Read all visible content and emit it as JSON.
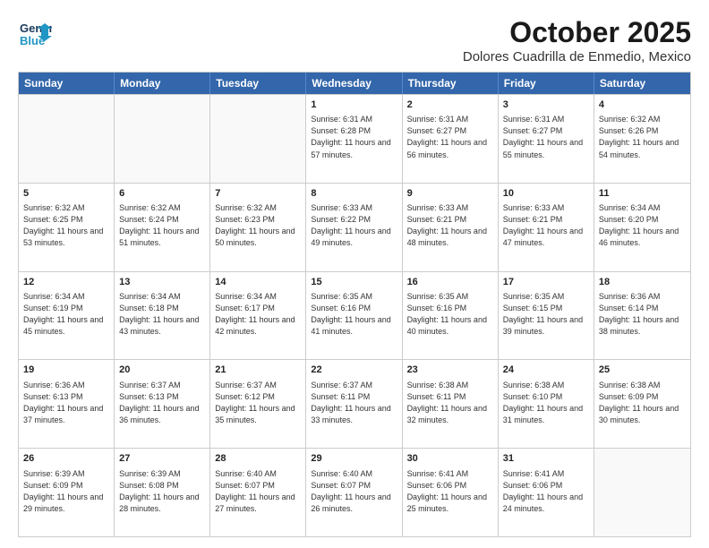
{
  "header": {
    "logo_general": "General",
    "logo_blue": "Blue",
    "month_title": "October 2025",
    "subtitle": "Dolores Cuadrilla de Enmedio, Mexico"
  },
  "days_of_week": [
    "Sunday",
    "Monday",
    "Tuesday",
    "Wednesday",
    "Thursday",
    "Friday",
    "Saturday"
  ],
  "weeks": [
    [
      {
        "day": "",
        "info": ""
      },
      {
        "day": "",
        "info": ""
      },
      {
        "day": "",
        "info": ""
      },
      {
        "day": "1",
        "info": "Sunrise: 6:31 AM\nSunset: 6:28 PM\nDaylight: 11 hours\nand 57 minutes."
      },
      {
        "day": "2",
        "info": "Sunrise: 6:31 AM\nSunset: 6:27 PM\nDaylight: 11 hours\nand 56 minutes."
      },
      {
        "day": "3",
        "info": "Sunrise: 6:31 AM\nSunset: 6:27 PM\nDaylight: 11 hours\nand 55 minutes."
      },
      {
        "day": "4",
        "info": "Sunrise: 6:32 AM\nSunset: 6:26 PM\nDaylight: 11 hours\nand 54 minutes."
      }
    ],
    [
      {
        "day": "5",
        "info": "Sunrise: 6:32 AM\nSunset: 6:25 PM\nDaylight: 11 hours\nand 53 minutes."
      },
      {
        "day": "6",
        "info": "Sunrise: 6:32 AM\nSunset: 6:24 PM\nDaylight: 11 hours\nand 51 minutes."
      },
      {
        "day": "7",
        "info": "Sunrise: 6:32 AM\nSunset: 6:23 PM\nDaylight: 11 hours\nand 50 minutes."
      },
      {
        "day": "8",
        "info": "Sunrise: 6:33 AM\nSunset: 6:22 PM\nDaylight: 11 hours\nand 49 minutes."
      },
      {
        "day": "9",
        "info": "Sunrise: 6:33 AM\nSunset: 6:21 PM\nDaylight: 11 hours\nand 48 minutes."
      },
      {
        "day": "10",
        "info": "Sunrise: 6:33 AM\nSunset: 6:21 PM\nDaylight: 11 hours\nand 47 minutes."
      },
      {
        "day": "11",
        "info": "Sunrise: 6:34 AM\nSunset: 6:20 PM\nDaylight: 11 hours\nand 46 minutes."
      }
    ],
    [
      {
        "day": "12",
        "info": "Sunrise: 6:34 AM\nSunset: 6:19 PM\nDaylight: 11 hours\nand 45 minutes."
      },
      {
        "day": "13",
        "info": "Sunrise: 6:34 AM\nSunset: 6:18 PM\nDaylight: 11 hours\nand 43 minutes."
      },
      {
        "day": "14",
        "info": "Sunrise: 6:34 AM\nSunset: 6:17 PM\nDaylight: 11 hours\nand 42 minutes."
      },
      {
        "day": "15",
        "info": "Sunrise: 6:35 AM\nSunset: 6:16 PM\nDaylight: 11 hours\nand 41 minutes."
      },
      {
        "day": "16",
        "info": "Sunrise: 6:35 AM\nSunset: 6:16 PM\nDaylight: 11 hours\nand 40 minutes."
      },
      {
        "day": "17",
        "info": "Sunrise: 6:35 AM\nSunset: 6:15 PM\nDaylight: 11 hours\nand 39 minutes."
      },
      {
        "day": "18",
        "info": "Sunrise: 6:36 AM\nSunset: 6:14 PM\nDaylight: 11 hours\nand 38 minutes."
      }
    ],
    [
      {
        "day": "19",
        "info": "Sunrise: 6:36 AM\nSunset: 6:13 PM\nDaylight: 11 hours\nand 37 minutes."
      },
      {
        "day": "20",
        "info": "Sunrise: 6:37 AM\nSunset: 6:13 PM\nDaylight: 11 hours\nand 36 minutes."
      },
      {
        "day": "21",
        "info": "Sunrise: 6:37 AM\nSunset: 6:12 PM\nDaylight: 11 hours\nand 35 minutes."
      },
      {
        "day": "22",
        "info": "Sunrise: 6:37 AM\nSunset: 6:11 PM\nDaylight: 11 hours\nand 33 minutes."
      },
      {
        "day": "23",
        "info": "Sunrise: 6:38 AM\nSunset: 6:11 PM\nDaylight: 11 hours\nand 32 minutes."
      },
      {
        "day": "24",
        "info": "Sunrise: 6:38 AM\nSunset: 6:10 PM\nDaylight: 11 hours\nand 31 minutes."
      },
      {
        "day": "25",
        "info": "Sunrise: 6:38 AM\nSunset: 6:09 PM\nDaylight: 11 hours\nand 30 minutes."
      }
    ],
    [
      {
        "day": "26",
        "info": "Sunrise: 6:39 AM\nSunset: 6:09 PM\nDaylight: 11 hours\nand 29 minutes."
      },
      {
        "day": "27",
        "info": "Sunrise: 6:39 AM\nSunset: 6:08 PM\nDaylight: 11 hours\nand 28 minutes."
      },
      {
        "day": "28",
        "info": "Sunrise: 6:40 AM\nSunset: 6:07 PM\nDaylight: 11 hours\nand 27 minutes."
      },
      {
        "day": "29",
        "info": "Sunrise: 6:40 AM\nSunset: 6:07 PM\nDaylight: 11 hours\nand 26 minutes."
      },
      {
        "day": "30",
        "info": "Sunrise: 6:41 AM\nSunset: 6:06 PM\nDaylight: 11 hours\nand 25 minutes."
      },
      {
        "day": "31",
        "info": "Sunrise: 6:41 AM\nSunset: 6:06 PM\nDaylight: 11 hours\nand 24 minutes."
      },
      {
        "day": "",
        "info": ""
      }
    ]
  ]
}
